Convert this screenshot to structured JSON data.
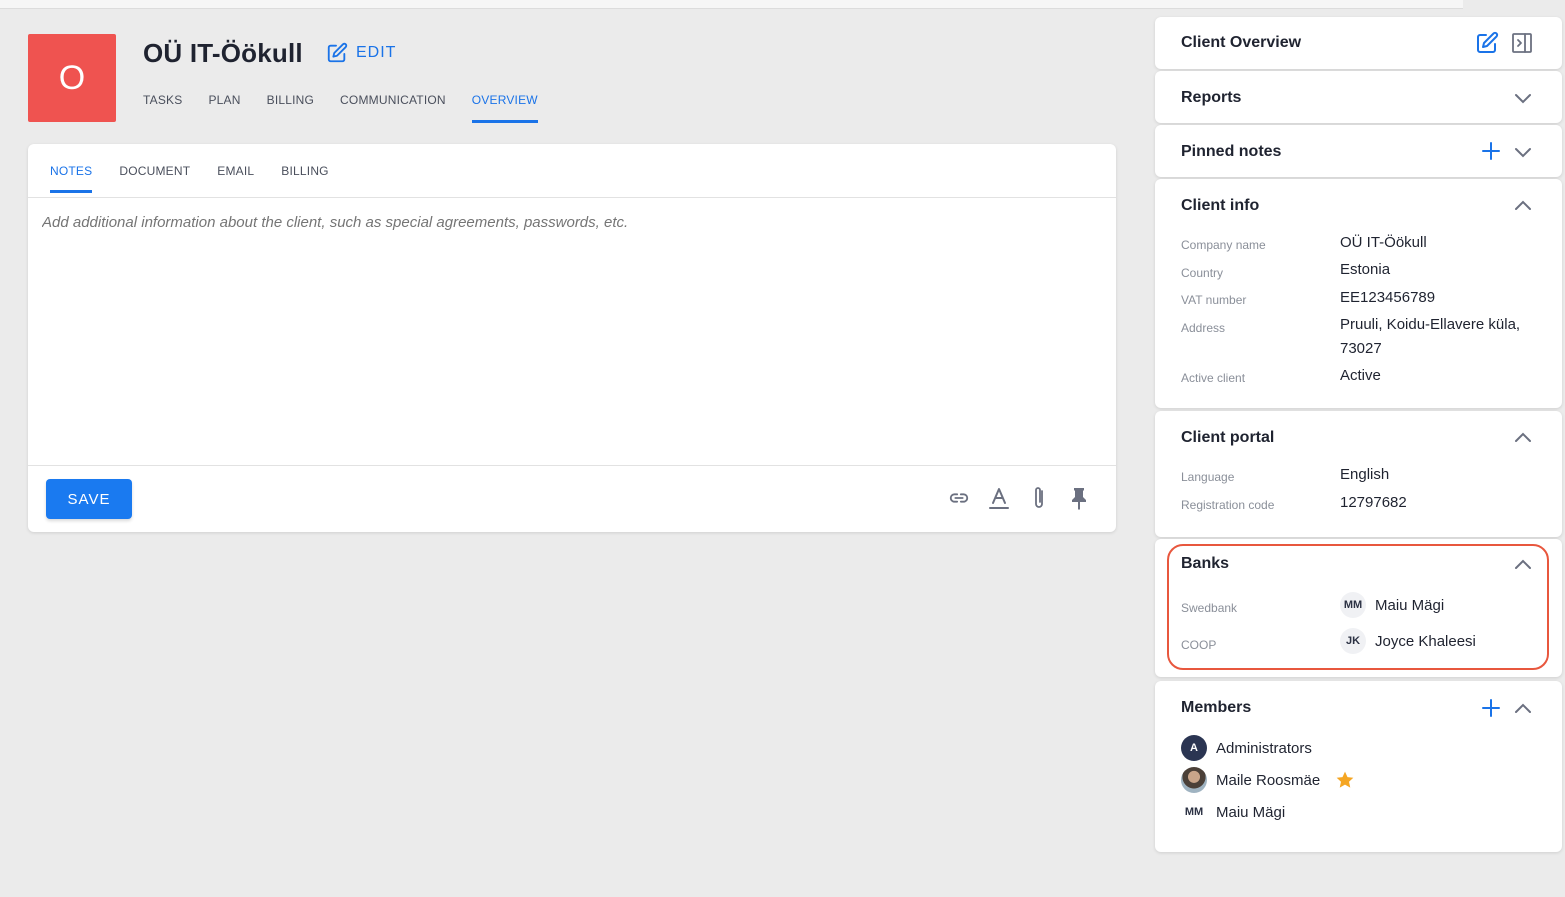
{
  "client": {
    "avatar_letter": "O",
    "name": "OÜ IT-Öökull",
    "edit_label": "EDIT",
    "avatar_color": "#ef5350"
  },
  "main_tabs": [
    "TASKS",
    "PLAN",
    "BILLING",
    "COMMUNICATION",
    "OVERVIEW"
  ],
  "main_tabs_active": "OVERVIEW",
  "notes": {
    "tabs": [
      "NOTES",
      "DOCUMENT",
      "EMAIL",
      "BILLING"
    ],
    "active_tab": "NOTES",
    "placeholder": "Add additional information about the client, such as special agreements, passwords, etc.",
    "save_label": "SAVE",
    "tool_icons": [
      "link-icon",
      "text-format-icon",
      "paperclip-icon",
      "pin-icon"
    ]
  },
  "sidebar": {
    "overview_title": "Client Overview",
    "reports_title": "Reports",
    "pinned_notes_title": "Pinned notes",
    "client_info": {
      "title": "Client info",
      "rows": [
        {
          "label": "Company name",
          "value": "OÜ IT-Öökull"
        },
        {
          "label": "Country",
          "value": "Estonia"
        },
        {
          "label": "VAT number",
          "value": "EE123456789"
        },
        {
          "label": "Address",
          "value": "Pruuli, Koidu-Ellavere küla, 73027"
        },
        {
          "label": "Active client",
          "value": "Active"
        }
      ]
    },
    "client_portal": {
      "title": "Client portal",
      "rows": [
        {
          "label": "Language",
          "value": "English"
        },
        {
          "label": "Registration code",
          "value": "12797682"
        }
      ]
    },
    "banks": {
      "title": "Banks",
      "rows": [
        {
          "label": "Swedbank",
          "initials": "MM",
          "person": "Maiu Mägi"
        },
        {
          "label": "COOP",
          "initials": "JK",
          "person": "Joyce Khaleesi"
        }
      ]
    },
    "members": {
      "title": "Members",
      "items": [
        {
          "initials": "A",
          "name": "Administrators"
        },
        {
          "initials": "",
          "name": "Maile Roosmäe",
          "starred": true
        },
        {
          "initials": "MM",
          "name": "Maiu Mägi"
        }
      ]
    }
  },
  "colors": {
    "accent": "#1a73e8",
    "highlight": "#e8573e",
    "star": "#f5a623"
  }
}
